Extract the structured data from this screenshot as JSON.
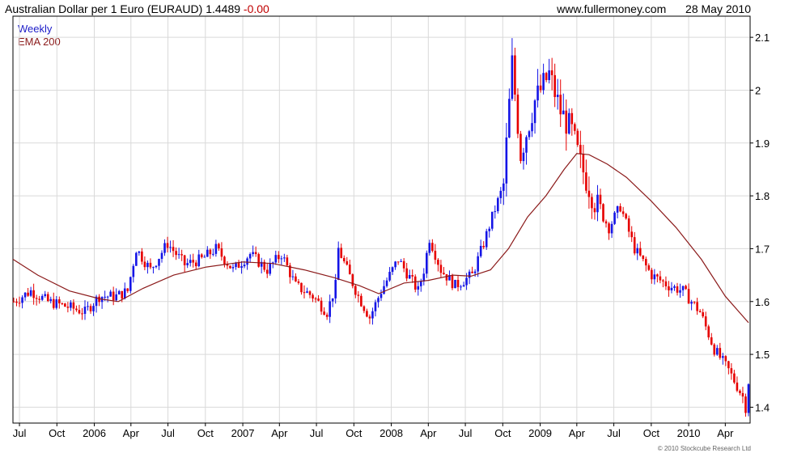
{
  "header": {
    "title": "Australian Dollar per 1 Euro (EURAUD)",
    "price": "1.4489",
    "change": "-0.00",
    "site": "www.fullermoney.com",
    "date": "28 May 2010"
  },
  "footer": {
    "copyright": "© 2010 Stockcube Research Ltd"
  },
  "colors": {
    "up": "#1414e6",
    "down": "#e60000",
    "ema": "#8b1a1a",
    "grid": "#d9d9d9",
    "axis": "#000000"
  },
  "chart_data": {
    "type": "candlestick",
    "legend": [
      "Weekly",
      "EMA 200"
    ],
    "legend_placement": "top-left",
    "y_axis_side": "right",
    "ylim": [
      1.37,
      2.14
    ],
    "yticks": [
      1.4,
      1.5,
      1.6,
      1.7,
      1.8,
      1.9,
      2,
      2.1
    ],
    "ytick_labels": [
      "1.4",
      "1.5",
      "1.6",
      "1.7",
      "1.8",
      "1.9",
      "2",
      "2.1"
    ],
    "grid": true,
    "x_range": [
      "2005-06-15",
      "2010-06-01"
    ],
    "xticks": [
      {
        "date": "2005-07-01",
        "label": "Jul"
      },
      {
        "date": "2005-10-01",
        "label": "Oct"
      },
      {
        "date": "2006-01-01",
        "label": "2006"
      },
      {
        "date": "2006-04-01",
        "label": "Apr"
      },
      {
        "date": "2006-07-01",
        "label": "Jul"
      },
      {
        "date": "2006-10-01",
        "label": "Oct"
      },
      {
        "date": "2007-01-01",
        "label": "2007"
      },
      {
        "date": "2007-04-01",
        "label": "Apr"
      },
      {
        "date": "2007-07-01",
        "label": "Jul"
      },
      {
        "date": "2007-10-01",
        "label": "Oct"
      },
      {
        "date": "2008-01-01",
        "label": "2008"
      },
      {
        "date": "2008-04-01",
        "label": "Apr"
      },
      {
        "date": "2008-07-01",
        "label": "Jul"
      },
      {
        "date": "2008-10-01",
        "label": "Oct"
      },
      {
        "date": "2009-01-01",
        "label": "2009"
      },
      {
        "date": "2009-04-01",
        "label": "Apr"
      },
      {
        "date": "2009-07-01",
        "label": "Jul"
      },
      {
        "date": "2009-10-01",
        "label": "Oct"
      },
      {
        "date": "2010-01-01",
        "label": "2010"
      },
      {
        "date": "2010-04-01",
        "label": "Apr"
      }
    ],
    "weekly_close_keypoints": [
      [
        "2005-06-17",
        1.6
      ],
      [
        "2005-07-29",
        1.62
      ],
      [
        "2005-09-09",
        1.6
      ],
      [
        "2005-10-28",
        1.59
      ],
      [
        "2005-12-09",
        1.58
      ],
      [
        "2006-01-13",
        1.61
      ],
      [
        "2006-02-24",
        1.61
      ],
      [
        "2006-03-24",
        1.62
      ],
      [
        "2006-04-14",
        1.7
      ],
      [
        "2006-05-19",
        1.66
      ],
      [
        "2006-06-30",
        1.71
      ],
      [
        "2006-08-11",
        1.67
      ],
      [
        "2006-09-22",
        1.68
      ],
      [
        "2006-10-27",
        1.7
      ],
      [
        "2006-12-08",
        1.66
      ],
      [
        "2007-01-19",
        1.69
      ],
      [
        "2007-03-02",
        1.66
      ],
      [
        "2007-04-06",
        1.69
      ],
      [
        "2007-05-11",
        1.63
      ],
      [
        "2007-06-22",
        1.61
      ],
      [
        "2007-07-27",
        1.58
      ],
      [
        "2007-08-17",
        1.63
      ],
      [
        "2007-08-24",
        1.7
      ],
      [
        "2007-09-14",
        1.66
      ],
      [
        "2007-10-12",
        1.61
      ],
      [
        "2007-11-09",
        1.57
      ],
      [
        "2007-12-07",
        1.62
      ],
      [
        "2008-01-18",
        1.68
      ],
      [
        "2008-03-07",
        1.62
      ],
      [
        "2008-03-21",
        1.66
      ],
      [
        "2008-04-04",
        1.72
      ],
      [
        "2008-05-02",
        1.66
      ],
      [
        "2008-06-06",
        1.63
      ],
      [
        "2008-07-18",
        1.65
      ],
      [
        "2008-08-15",
        1.71
      ],
      [
        "2008-09-05",
        1.76
      ],
      [
        "2008-10-03",
        1.82
      ],
      [
        "2008-10-24",
        2.05
      ],
      [
        "2008-11-14",
        1.88
      ],
      [
        "2008-12-19",
        1.98
      ],
      [
        "2009-01-23",
        2.03
      ],
      [
        "2009-02-20",
        1.96
      ],
      [
        "2009-03-20",
        1.92
      ],
      [
        "2009-04-10",
        1.86
      ],
      [
        "2009-05-15",
        1.79
      ],
      [
        "2009-06-19",
        1.74
      ],
      [
        "2009-07-17",
        1.78
      ],
      [
        "2009-08-21",
        1.7
      ],
      [
        "2009-10-02",
        1.65
      ],
      [
        "2009-11-13",
        1.63
      ],
      [
        "2009-12-18",
        1.62
      ],
      [
        "2010-01-29",
        1.58
      ],
      [
        "2010-03-05",
        1.51
      ],
      [
        "2010-04-09",
        1.47
      ],
      [
        "2010-05-14",
        1.42
      ],
      [
        "2010-05-21",
        1.4
      ],
      [
        "2010-05-28",
        1.4489
      ]
    ],
    "ema200": [
      [
        "2005-06-15",
        1.68
      ],
      [
        "2005-08-15",
        1.65
      ],
      [
        "2005-11-01",
        1.62
      ],
      [
        "2006-01-15",
        1.605
      ],
      [
        "2006-03-01",
        1.6
      ],
      [
        "2006-05-01",
        1.625
      ],
      [
        "2006-07-15",
        1.65
      ],
      [
        "2006-10-01",
        1.665
      ],
      [
        "2007-01-01",
        1.675
      ],
      [
        "2007-03-15",
        1.672
      ],
      [
        "2007-06-01",
        1.66
      ],
      [
        "2007-08-15",
        1.645
      ],
      [
        "2007-10-15",
        1.63
      ],
      [
        "2007-12-01",
        1.615
      ],
      [
        "2008-02-01",
        1.635
      ],
      [
        "2008-04-01",
        1.64
      ],
      [
        "2008-06-01",
        1.65
      ],
      [
        "2008-07-15",
        1.648
      ],
      [
        "2008-09-01",
        1.66
      ],
      [
        "2008-10-15",
        1.7
      ],
      [
        "2008-12-01",
        1.76
      ],
      [
        "2009-01-15",
        1.8
      ],
      [
        "2009-03-01",
        1.85
      ],
      [
        "2009-04-01",
        1.88
      ],
      [
        "2009-05-01",
        1.878
      ],
      [
        "2009-06-15",
        1.86
      ],
      [
        "2009-08-01",
        1.835
      ],
      [
        "2009-10-01",
        1.79
      ],
      [
        "2009-12-01",
        1.74
      ],
      [
        "2010-02-01",
        1.68
      ],
      [
        "2010-04-01",
        1.61
      ],
      [
        "2010-05-28",
        1.56
      ]
    ]
  }
}
